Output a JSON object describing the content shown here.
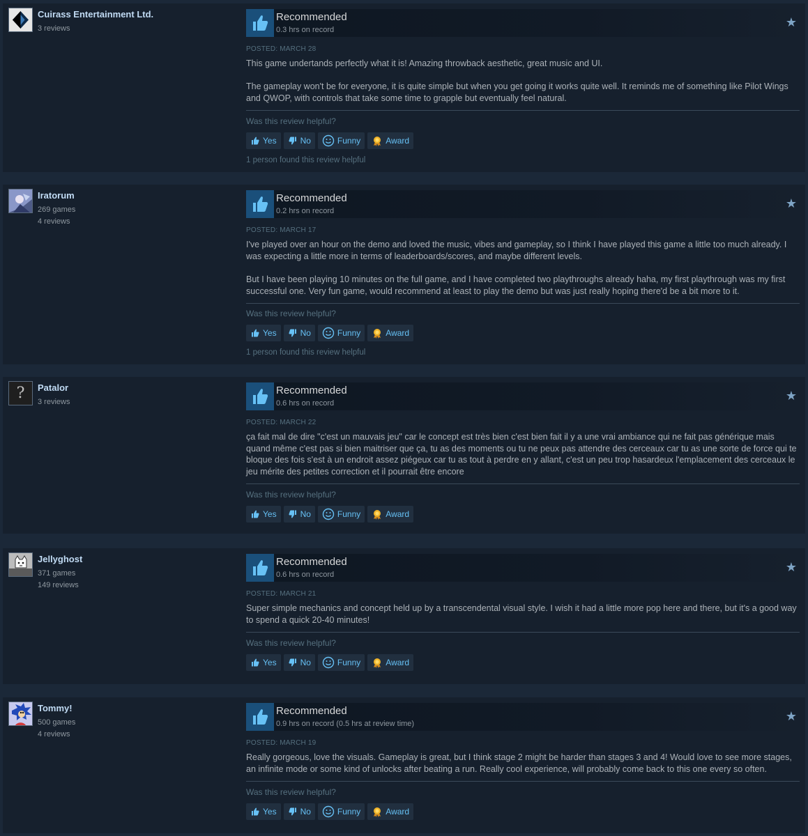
{
  "ui": {
    "recommended_label": "Recommended",
    "posted_prefix": "Posted: ",
    "helpful_question": "Was this review helpful?",
    "yes_label": "Yes",
    "no_label": "No",
    "funny_label": "Funny",
    "award_label": "Award"
  },
  "colors": {
    "page_bg": "#1b2838",
    "card_bg": "#16202d",
    "author_name": "#c1dbf4",
    "link_blue": "#66c0f4",
    "thumb_bg": "#1a4f7a"
  },
  "reviews": [
    {
      "author": "Cuirass Entertainment Ltd.",
      "author_stats": [
        "3 reviews"
      ],
      "avatar_icon": "diamond-logo-icon",
      "hours": "0.3 hrs on record",
      "posted": "March 28",
      "paragraphs": [
        "This game undertands perfectly what it is! Amazing throwback aesthetic, great music and UI.",
        "The gameplay won't be for everyone, it is quite simple but when you get going it works quite well. It reminds me of something like Pilot Wings and QWOP, with controls that take some time to grapple but eventually feel natural."
      ],
      "found_helpful": "1 person found this review helpful"
    },
    {
      "author": "Iratorum",
      "author_stats": [
        "269 games",
        "4 reviews"
      ],
      "avatar_icon": "anime-avatar-icon",
      "hours": "0.2 hrs on record",
      "posted": "March 17",
      "paragraphs": [
        "I've played over an hour on the demo and loved the music, vibes and gameplay, so I think I have played this game a little too much already. I was expecting a little more in terms of leaderboards/scores, and maybe different levels.",
        "But I have been playing 10 minutes on the full game, and I have completed two playthroughs already haha, my first playthrough was my first successful one. Very fun game, would recommend at least to play the demo but was just really hoping there'd be a bit more to it."
      ],
      "found_helpful": "1 person found this review helpful"
    },
    {
      "author": "Patalor",
      "author_stats": [
        "3 reviews"
      ],
      "avatar_icon": "question-mark-avatar-icon",
      "avatar_glyph": "?",
      "hours": "0.6 hrs on record",
      "posted": "March 22",
      "paragraphs": [
        "ça fait mal de dire \"c'est un mauvais jeu\" car le concept est très bien c'est bien fait il y a une vrai ambiance qui ne fait pas générique mais quand même c'est pas si bien maitriser que ça, tu as des moments ou tu ne peux pas attendre des cerceaux car tu as une sorte de force qui te bloque des fois s'est à un endroit assez piégeux car tu as tout à perdre en y allant, c'est un peu trop hasardeux l'emplacement des cerceaux le jeu mérite des petites correction et il pourrait être encore"
      ],
      "found_helpful": ""
    },
    {
      "author": "Jellyghost",
      "author_stats": [
        "371 games",
        "149 reviews"
      ],
      "avatar_icon": "ghost-avatar-icon",
      "hours": "0.6 hrs on record",
      "posted": "March 21",
      "paragraphs": [
        "Super simple mechanics and concept held up by a transcendental visual style. I wish it had a little more pop here and there, but it's a good way to spend a quick 20-40 minutes!"
      ],
      "found_helpful": ""
    },
    {
      "author": "Tommy!",
      "author_stats": [
        "500 games",
        "4 reviews"
      ],
      "avatar_icon": "hedgehog-avatar-icon",
      "hours": "0.9 hrs on record (0.5 hrs at review time)",
      "posted": "March 19",
      "paragraphs": [
        "Really gorgeous, love the visuals. Gameplay is great, but I think stage 2 might be harder than stages 3 and 4! Would love to see more stages, an infinite mode or some kind of unlocks after beating a run. Really cool experience, will probably come back to this one every so often."
      ],
      "found_helpful": ""
    }
  ]
}
